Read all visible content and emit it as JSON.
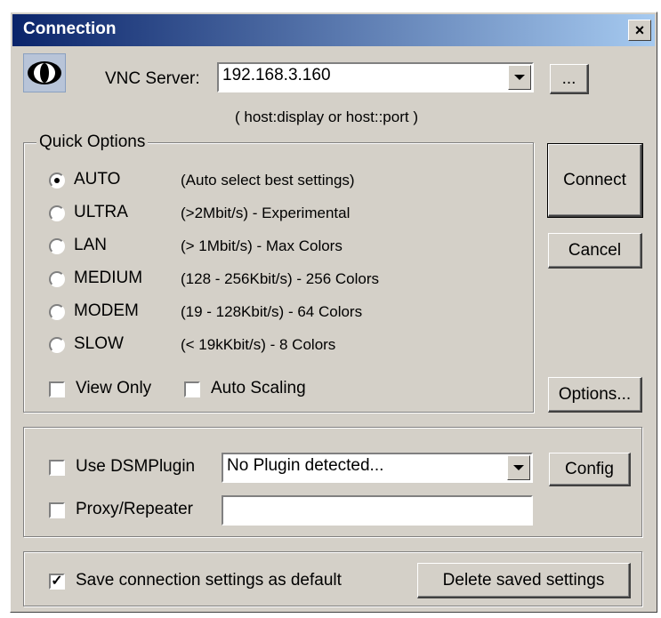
{
  "window": {
    "title": "Connection",
    "close_glyph": "×"
  },
  "server": {
    "label": "VNC Server:",
    "value": "192.168.3.160",
    "hint": "( host:display or host::port )",
    "browse_label": "..."
  },
  "quick_options": {
    "legend": "Quick Options",
    "options": [
      {
        "name": "AUTO",
        "desc": "(Auto select best settings)",
        "selected": true
      },
      {
        "name": "ULTRA",
        "desc": "(>2Mbit/s) - Experimental",
        "selected": false
      },
      {
        "name": "LAN",
        "desc": "(> 1Mbit/s) - Max Colors",
        "selected": false
      },
      {
        "name": "MEDIUM",
        "desc": "(128 - 256Kbit/s) - 256 Colors",
        "selected": false
      },
      {
        "name": "MODEM",
        "desc": "(19 - 128Kbit/s) - 64 Colors",
        "selected": false
      },
      {
        "name": "SLOW",
        "desc": "(< 19kKbit/s) - 8 Colors",
        "selected": false
      }
    ],
    "view_only": {
      "label": "View Only",
      "checked": false
    },
    "auto_scaling": {
      "label": "Auto Scaling",
      "checked": false
    }
  },
  "buttons": {
    "connect": "Connect",
    "cancel": "Cancel",
    "options": "Options...",
    "config": "Config",
    "delete_saved": "Delete saved settings"
  },
  "plugin": {
    "use_label": "Use DSMPlugin",
    "checked": false,
    "value": "No Plugin detected..."
  },
  "proxy": {
    "label": "Proxy/Repeater",
    "checked": false,
    "value": ""
  },
  "save": {
    "label": "Save connection settings as default",
    "checked": true,
    "check_glyph": "✓"
  }
}
